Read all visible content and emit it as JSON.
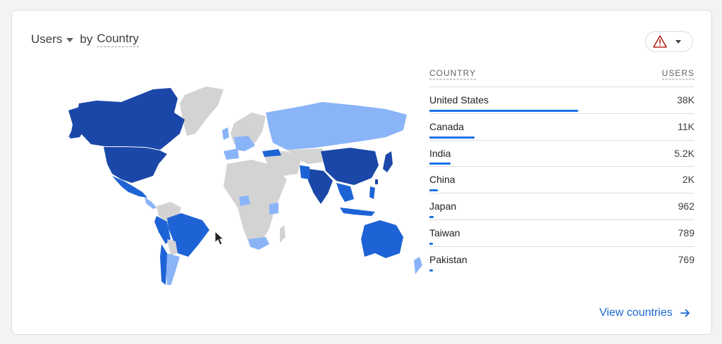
{
  "card": {
    "metric_label": "Users",
    "by_text": "by",
    "dimension_label": "Country"
  },
  "colors": {
    "dark": "#1a47a8",
    "medium": "#1e63d6",
    "light": "#8ab4f8",
    "none": "#d3d3d3",
    "bar": "#1a73e8",
    "link": "#1967d2"
  },
  "warning_button": {
    "icon": "warning-icon"
  },
  "table": {
    "col_country": "COUNTRY",
    "col_users": "USERS",
    "rows": [
      {
        "country": "United States",
        "users": "38K",
        "share": 0.56
      },
      {
        "country": "Canada",
        "users": "11K",
        "share": 0.17
      },
      {
        "country": "India",
        "users": "5.2K",
        "share": 0.08
      },
      {
        "country": "China",
        "users": "2K",
        "share": 0.032
      },
      {
        "country": "Japan",
        "users": "962",
        "share": 0.016
      },
      {
        "country": "Taiwan",
        "users": "789",
        "share": 0.013
      },
      {
        "country": "Pakistan",
        "users": "769",
        "share": 0.012
      }
    ]
  },
  "footer": {
    "link_label": "View countries"
  }
}
